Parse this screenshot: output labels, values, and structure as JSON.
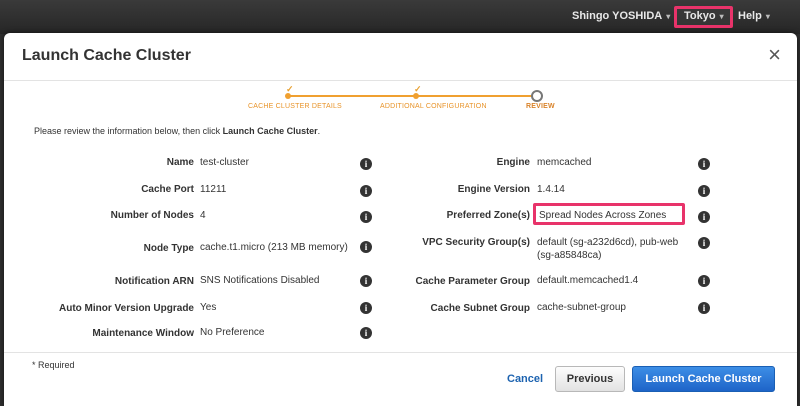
{
  "topbar": {
    "user": "Shingo YOSHIDA",
    "region": "Tokyo",
    "help": "Help",
    "caret": "▾"
  },
  "modal": {
    "title": "Launch Cache Cluster",
    "close_icon": "×",
    "intro_prefix": "Please review the information below, then click ",
    "intro_bold": "Launch Cache Cluster",
    "intro_suffix": "."
  },
  "wizard": {
    "steps": [
      {
        "label": "CACHE CLUSTER DETAILS",
        "state": "complete"
      },
      {
        "label": "ADDITIONAL CONFIGURATION",
        "state": "complete"
      },
      {
        "label": "REVIEW",
        "state": "active"
      }
    ],
    "check": "✓"
  },
  "left_fields": [
    {
      "label": "Name",
      "value": "test-cluster"
    },
    {
      "label": "Cache Port",
      "value": "11211"
    },
    {
      "label": "Number of Nodes",
      "value": "4"
    },
    {
      "label": "Node Type",
      "value": "cache.t1.micro (213 MB memory)"
    },
    {
      "label": "Notification ARN",
      "value": "SNS Notifications Disabled"
    },
    {
      "label": "Auto Minor Version Upgrade",
      "value": "Yes"
    },
    {
      "label": "Maintenance Window",
      "value": "No Preference"
    }
  ],
  "right_fields": [
    {
      "label": "Engine",
      "value": "memcached"
    },
    {
      "label": "Engine Version",
      "value": "1.4.14"
    },
    {
      "label": "Preferred Zone(s)",
      "value": "Spread Nodes Across Zones"
    },
    {
      "label": "VPC Security Group(s)",
      "value": "default (sg-a232d6cd), pub-web",
      "value2": "(sg-a85848ca)"
    },
    {
      "label": "Cache Parameter Group",
      "value": "default.memcached1.4"
    },
    {
      "label": "Cache Subnet Group",
      "value": "cache-subnet-group"
    }
  ],
  "info_icon": "i",
  "footer": {
    "required_note": "* Required",
    "cancel": "Cancel",
    "previous": "Previous",
    "launch": "Launch Cache Cluster"
  },
  "colors": {
    "highlight": "#e8336a",
    "primary": "#1e64c8",
    "wizard_accent": "#f0a030"
  }
}
